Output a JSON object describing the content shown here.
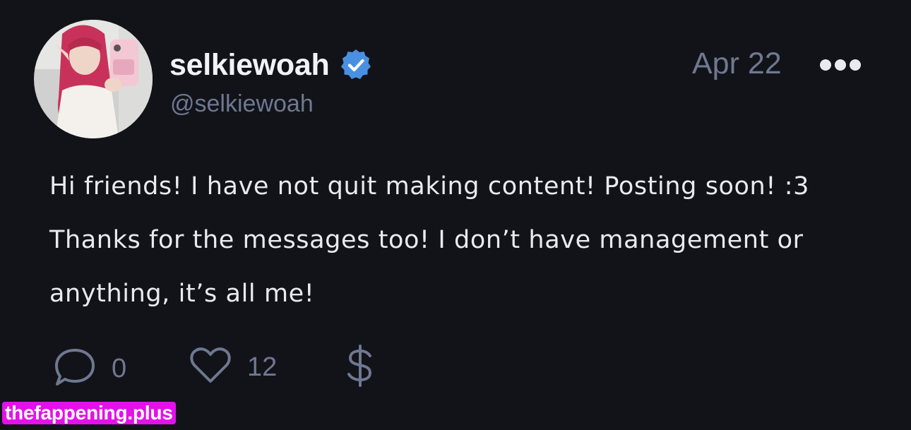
{
  "post": {
    "author": {
      "display_name": "selkiewoah",
      "handle": "@selkiewoah",
      "verified": true
    },
    "date": "Apr 22",
    "body_lines": [
      "Hi friends! I have not quit making content! Posting soon! :3",
      "Thanks for the messages too! I don’t have management or",
      "anything, it’s all me!"
    ],
    "actions": {
      "reply_count": "0",
      "like_count": "12"
    }
  },
  "watermark": {
    "text": "thefappening.plus"
  },
  "colors": {
    "background": "#121318",
    "text_primary": "#e9eaef",
    "text_muted": "#6f7891",
    "verified_badge": "#4a90e2",
    "watermark_bg": "#e312e9"
  },
  "icons": [
    "verified-badge-icon",
    "more-options-icon",
    "reply-icon",
    "like-icon",
    "tip-dollar-icon"
  ]
}
